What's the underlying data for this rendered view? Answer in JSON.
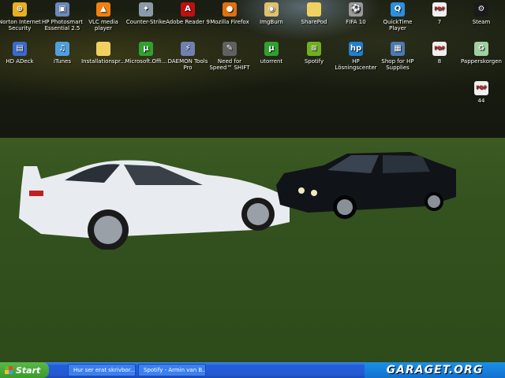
{
  "desktop_icons": [
    {
      "label": "Norton Internet Security",
      "icon": "norton-icon",
      "color": "#e8b020",
      "glyph": "⊕"
    },
    {
      "label": "HP Photosmart Essential 2.5",
      "icon": "hp-photosmart-icon",
      "color": "#6a8ab8",
      "glyph": "▣"
    },
    {
      "label": "VLC media player",
      "icon": "vlc-icon",
      "color": "#f08010",
      "glyph": "▲"
    },
    {
      "label": "Counter-Strike",
      "icon": "counter-strike-icon",
      "color": "#8a9aa8",
      "glyph": "✦"
    },
    {
      "label": "Adobe Reader 9",
      "icon": "adobe-reader-icon",
      "color": "#c01010",
      "glyph": "A"
    },
    {
      "label": "Mozilla Firefox",
      "icon": "firefox-icon",
      "color": "#e07010",
      "glyph": "●"
    },
    {
      "label": "ImgBurn",
      "icon": "imgburn-icon",
      "color": "#e0c070",
      "glyph": "◉"
    },
    {
      "label": "SharePod",
      "icon": "folder-icon",
      "color": "#f0d060",
      "glyph": ""
    },
    {
      "label": "FIFA 10",
      "icon": "fifa-icon",
      "color": "#9a9a9a",
      "glyph": "⚽"
    },
    {
      "label": "QuickTime Player",
      "icon": "quicktime-icon",
      "color": "#2a90e0",
      "glyph": "Q"
    },
    {
      "label": "7",
      "icon": "pdf-icon",
      "color": "#f0f0f0",
      "glyph": "PDF"
    },
    {
      "label": "Steam",
      "icon": "steam-icon",
      "color": "#1a1a1a",
      "glyph": "⚙"
    },
    {
      "label": "HD ADeck",
      "icon": "hd-adeck-icon",
      "color": "#3a6ad0",
      "glyph": "▤"
    },
    {
      "label": "iTunes",
      "icon": "itunes-icon",
      "color": "#50a0e0",
      "glyph": "♫"
    },
    {
      "label": "Installationspr...",
      "icon": "folder-icon",
      "color": "#f0d060",
      "glyph": ""
    },
    {
      "label": "Microsoft.Offi...",
      "icon": "utorrent-icon",
      "color": "#30a030",
      "glyph": "µ"
    },
    {
      "label": "DAEMON Tools Pro",
      "icon": "daemon-tools-icon",
      "color": "#7080b0",
      "glyph": "⚡"
    },
    {
      "label": "Need for Speed™ SHIFT",
      "icon": "need-for-speed-icon",
      "color": "#606060",
      "glyph": "✎"
    },
    {
      "label": "utorrent",
      "icon": "utorrent-icon",
      "color": "#30a030",
      "glyph": "µ"
    },
    {
      "label": "Spotify",
      "icon": "spotify-icon",
      "color": "#70b020",
      "glyph": "≋"
    },
    {
      "label": "HP Lösningscenter",
      "icon": "hp-solution-center-icon",
      "color": "#2080d0",
      "glyph": "hp"
    },
    {
      "label": "Shop for HP Supplies",
      "icon": "hp-shop-icon",
      "color": "#4a7ab0",
      "glyph": "▦"
    },
    {
      "label": "8",
      "icon": "pdf-icon",
      "color": "#f0f0f0",
      "glyph": "PDF"
    },
    {
      "label": "Papperskorgen",
      "icon": "recycle-bin-icon",
      "color": "#a0d0a0",
      "glyph": "♻"
    },
    {
      "label": "44",
      "icon": "pdf-icon",
      "color": "#f0f0f0",
      "glyph": "PDF"
    }
  ],
  "taskbar": {
    "start_label": "Start",
    "tasks": [
      {
        "label": "Hur ser erat skrivbor...",
        "icon": "firefox-icon",
        "color": "#e07010"
      },
      {
        "label": "Spotify - Armin van B...",
        "icon": "spotify-icon",
        "color": "#70b020"
      }
    ],
    "watermark": "GARAGET.ORG"
  }
}
